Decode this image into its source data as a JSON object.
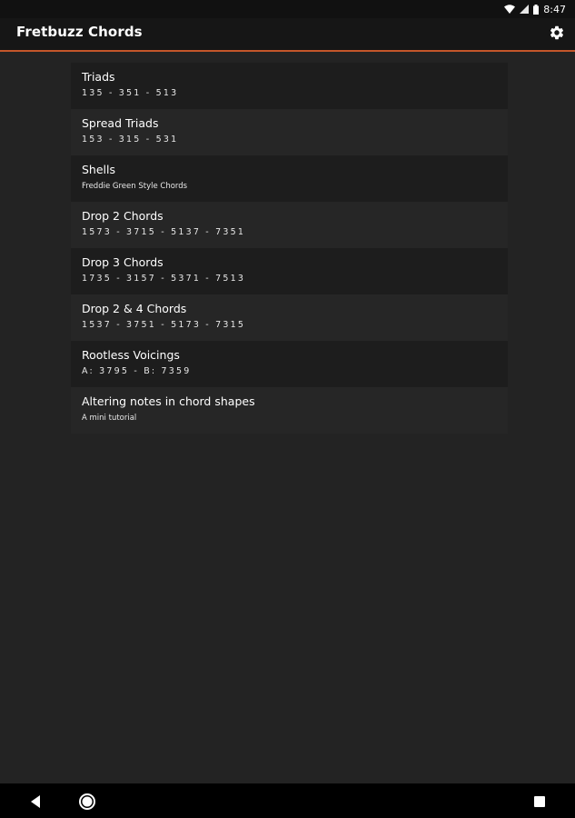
{
  "status_bar": {
    "time": "8:47"
  },
  "app_bar": {
    "title": "Fretbuzz Chords",
    "settings_icon": "gear-icon"
  },
  "colors": {
    "accent": "#c4562a",
    "background": "#232323"
  },
  "items": [
    {
      "title": "Triads",
      "subtitle": "135 - 351 - 513"
    },
    {
      "title": "Spread Triads",
      "subtitle": "153 - 315 - 531"
    },
    {
      "title": "Shells",
      "subtitle": "Freddie Green Style Chords"
    },
    {
      "title": "Drop 2 Chords",
      "subtitle": "1573 - 3715 - 5137 - 7351"
    },
    {
      "title": "Drop 3 Chords",
      "subtitle": "1735 - 3157 - 5371 - 7513"
    },
    {
      "title": "Drop 2 & 4 Chords",
      "subtitle": "1537 - 3751 - 5173 - 7315"
    },
    {
      "title": "Rootless Voicings",
      "subtitle": "A: 3795 - B: 7359"
    },
    {
      "title": "Altering notes in chord shapes",
      "subtitle": "A mini tutorial"
    }
  ],
  "nav_bar": {
    "back_icon": "back-icon",
    "home_icon": "home-icon",
    "recents_icon": "recents-icon"
  }
}
